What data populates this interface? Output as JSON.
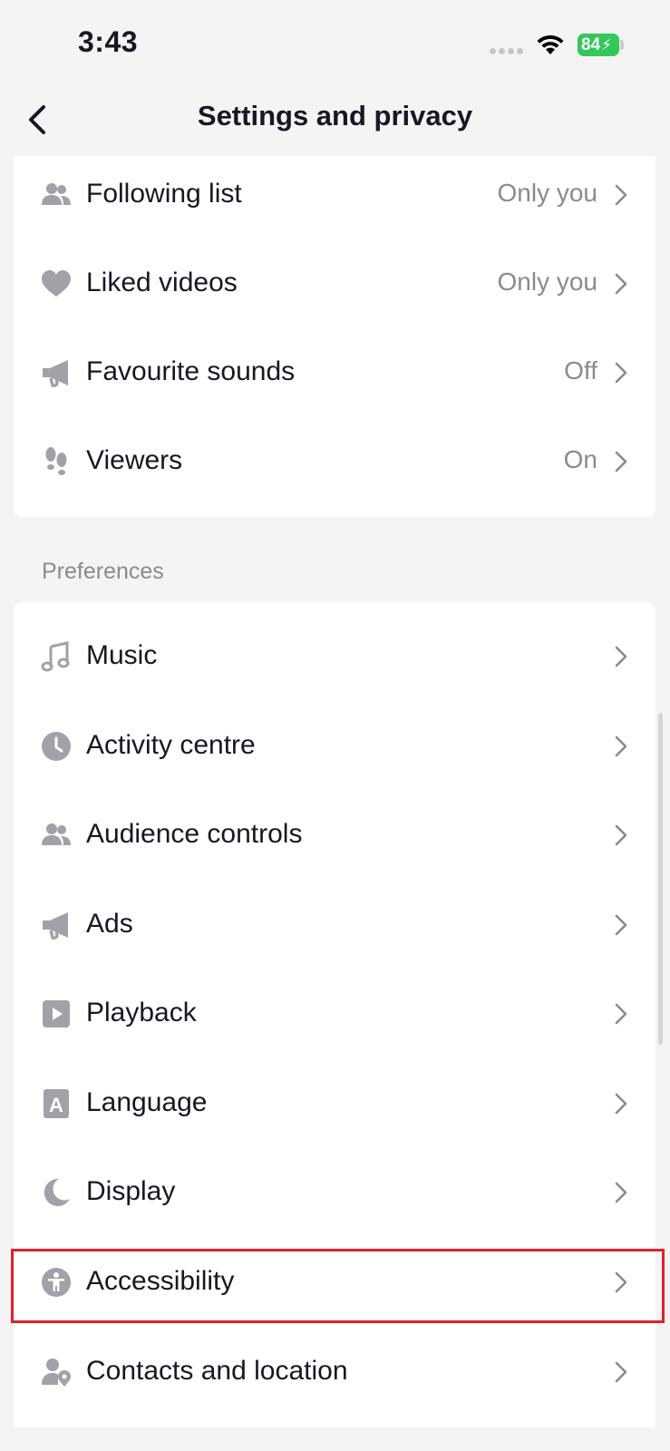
{
  "status_bar": {
    "time": "3:43",
    "battery": "84",
    "battery_color": "#34c759"
  },
  "nav": {
    "title": "Settings and privacy",
    "back_icon": "chevron-left-icon"
  },
  "top_items": [
    {
      "label": "Following list",
      "value": "Only you",
      "icon": "people-icon"
    },
    {
      "label": "Liked videos",
      "value": "Only you",
      "icon": "heart-icon"
    },
    {
      "label": "Favourite sounds",
      "value": "Off",
      "icon": "megaphone-icon"
    },
    {
      "label": "Viewers",
      "value": "On",
      "icon": "footprints-icon"
    }
  ],
  "preferences": {
    "section_label": "Preferences",
    "items": [
      {
        "label": "Music",
        "icon": "music-note-icon"
      },
      {
        "label": "Activity centre",
        "icon": "clock-icon"
      },
      {
        "label": "Audience controls",
        "icon": "people-icon"
      },
      {
        "label": "Ads",
        "icon": "megaphone-icon"
      },
      {
        "label": "Playback",
        "icon": "play-icon"
      },
      {
        "label": "Language",
        "icon": "letter-a-icon",
        "glyph": "A"
      },
      {
        "label": "Display",
        "icon": "moon-icon"
      },
      {
        "label": "Accessibility",
        "icon": "accessibility-icon",
        "highlighted": true
      },
      {
        "label": "Contacts and location",
        "icon": "person-location-icon"
      }
    ]
  },
  "colors": {
    "highlight": "#e0202e",
    "icon_gray": "#a1a2a7",
    "value_gray": "#8a8b91"
  }
}
